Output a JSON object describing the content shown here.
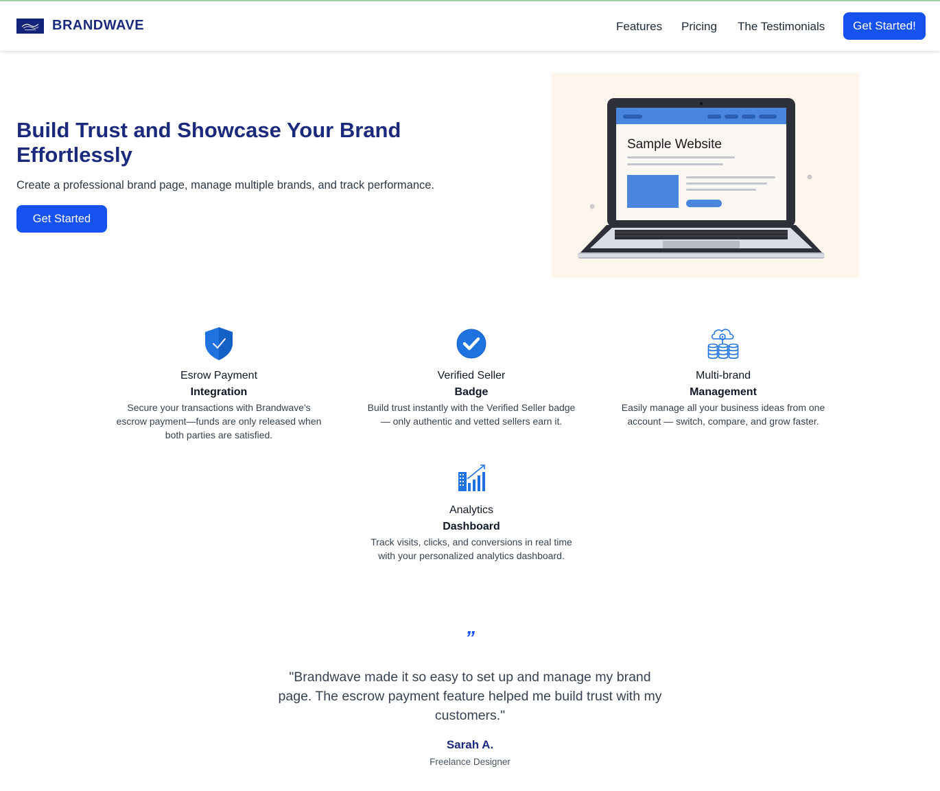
{
  "nav": {
    "brand": "BRANDWAVE",
    "links": [
      "Features",
      "Pricing",
      "The Testimonials"
    ],
    "cta": "Get Started!"
  },
  "hero": {
    "title": "Build Trust and Showcase Your Brand Effortlessly",
    "subtitle": "Create a professional brand page, manage multiple brands, and track performance.",
    "cta": "Get Started",
    "image_text": "Sample Website"
  },
  "features": [
    {
      "icon": "shield-check-icon",
      "title": "Esrow Payment",
      "subtitle": "Integration",
      "description": "Secure your transactions with Brandwave's escrow payment—funds are only released when both parties are satisfied."
    },
    {
      "icon": "verified-badge-icon",
      "title": "Verified Seller",
      "subtitle": "Badge",
      "description": "Build trust instantly with the Verified Seller badge — only authentic and vetted sellers earn it."
    },
    {
      "icon": "multi-brand-icon",
      "title": "Multi-brand",
      "subtitle": "Management",
      "description": "Easily manage all your business ideas from one account — switch, compare, and grow faster."
    },
    {
      "icon": "analytics-icon",
      "title": "Analytics",
      "subtitle": "Dashboard",
      "description": "Track visits, clicks, and conversions in real time with your personalized analytics dashboard."
    }
  ],
  "testimonial": {
    "mark": "”",
    "quote": "\"Brandwave made it so easy to set up and manage my brand page. The escrow payment feature helped me build trust with my customers.\"",
    "author": "Sarah A.",
    "role": "Freelance Designer"
  },
  "colors": {
    "primary": "#1652f0",
    "brand_navy": "#1b2a7d",
    "hero_image_bg": "#fef6ec"
  }
}
